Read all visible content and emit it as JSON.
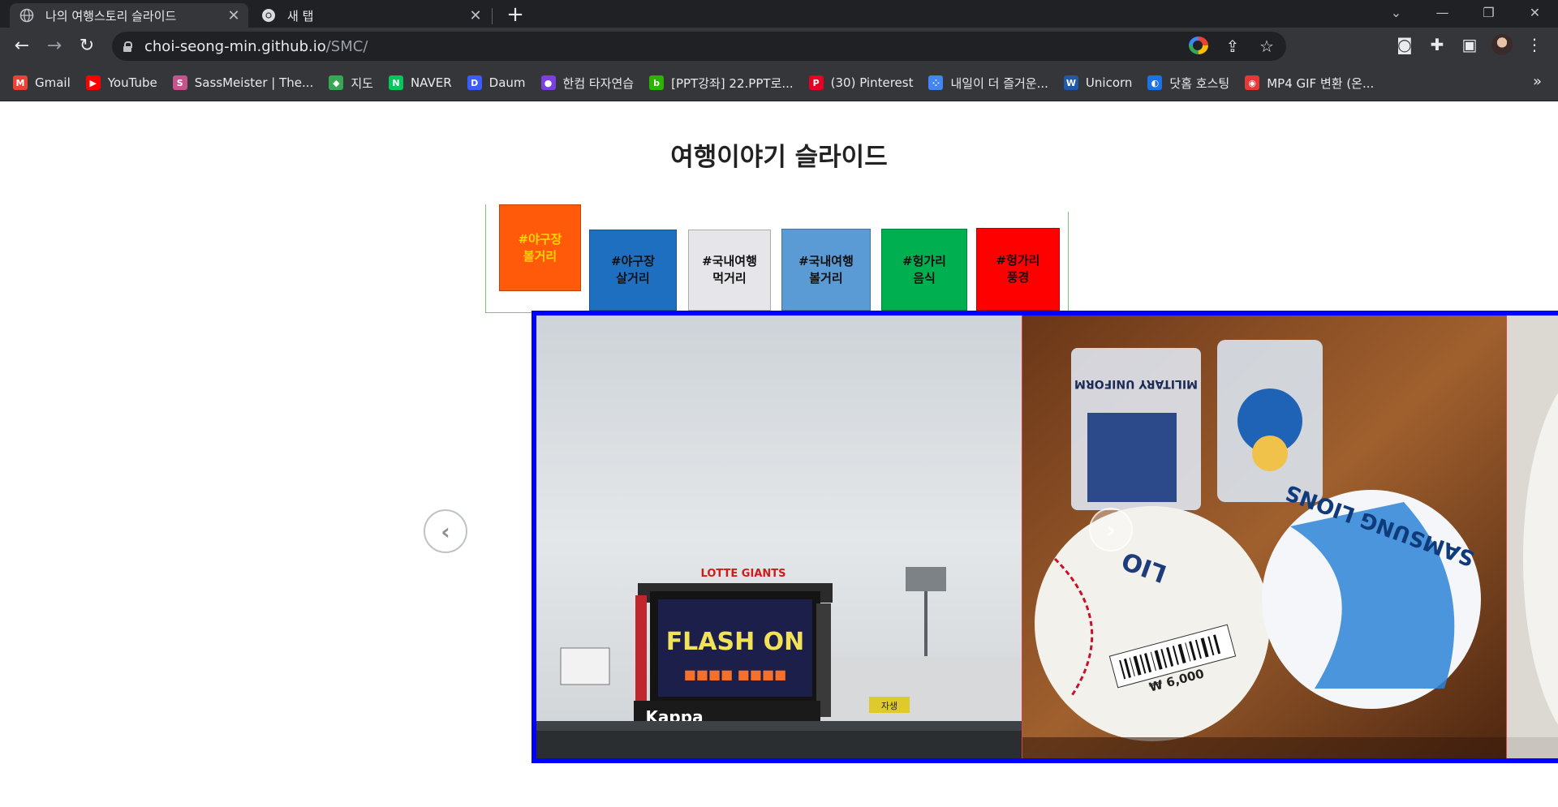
{
  "browser": {
    "tabs": [
      {
        "title": "나의 여행스토리 슬라이드",
        "icon": "globe-icon",
        "active": true
      },
      {
        "title": "새 탭",
        "icon": "chrome-icon",
        "active": false
      }
    ],
    "new_tab_symbol": "+",
    "window_controls": {
      "dropdown": "⌄",
      "minimize": "—",
      "restore": "❐",
      "close": "✕"
    },
    "url_host": "choi-seong-min.github.io",
    "url_path": "/SMC/",
    "bookmarks": [
      {
        "label": "Gmail",
        "icon": "gmail-icon",
        "color": "#ea4335",
        "glyph": "M"
      },
      {
        "label": "YouTube",
        "icon": "youtube-icon",
        "color": "#ff0000",
        "glyph": "▶"
      },
      {
        "label": "SassMeister | The...",
        "icon": "sassmeister-icon",
        "color": "#c6538c",
        "glyph": "S"
      },
      {
        "label": "지도",
        "icon": "maps-icon",
        "color": "#34a853",
        "glyph": "◆"
      },
      {
        "label": "NAVER",
        "icon": "naver-icon",
        "color": "#03c75a",
        "glyph": "N"
      },
      {
        "label": "Daum",
        "icon": "daum-icon",
        "color": "#3b5cff",
        "glyph": "D"
      },
      {
        "label": "한컴 타자연습",
        "icon": "hancom-icon",
        "color": "#7b3fe4",
        "glyph": "●"
      },
      {
        "label": "[PPT강좌] 22.PPT로...",
        "icon": "blog-icon",
        "color": "#2db400",
        "glyph": "b"
      },
      {
        "label": "(30) Pinterest",
        "icon": "pinterest-icon",
        "color": "#e60023",
        "glyph": "P"
      },
      {
        "label": "내일이 더 즐거운...",
        "icon": "app-grid-icon",
        "color": "#4285f4",
        "glyph": "⁘"
      },
      {
        "label": "Unicorn",
        "icon": "w3-icon",
        "color": "#1e5aa8",
        "glyph": "W"
      },
      {
        "label": "닷홈 호스팅",
        "icon": "dothome-icon",
        "color": "#1a73e8",
        "glyph": "◐"
      },
      {
        "label": "MP4 GIF 변환 (온...",
        "icon": "converter-icon",
        "color": "#e53935",
        "glyph": "◉"
      }
    ],
    "more_bookmarks": "»"
  },
  "page": {
    "heading": "여행이야기 슬라이드",
    "categories": [
      {
        "label": "#야구장\n볼거리",
        "bg": "#ff5a0a",
        "text_color": "#ffd400"
      },
      {
        "label": "#야구장\n살거리",
        "bg": "#1f6fc0",
        "text_color": "#111111"
      },
      {
        "label": "#국내여행\n먹거리",
        "bg": "#e6e6ea",
        "text_color": "#111111"
      },
      {
        "label": "#국내여행\n볼거리",
        "bg": "#5b9bd5",
        "text_color": "#111111"
      },
      {
        "label": "#헝가리\n음식",
        "bg": "#00b050",
        "text_color": "#111111"
      },
      {
        "label": "#헝가리\n풍경",
        "bg": "#ff0000",
        "text_color": "#111111"
      }
    ],
    "slides": [
      {
        "scoreboard_text": "FLASH ON",
        "team_sign": "LOTTE GIANTS",
        "ad_text": "Kappa"
      },
      {
        "ball_text": "SAMSUNG LIONS",
        "price_text": "₩ 6,000",
        "tag_text": "MILITARY UNIFORM"
      },
      {}
    ],
    "prev_arrow": "‹",
    "next_arrow": "›",
    "slider_border_color": "#0000ff"
  }
}
